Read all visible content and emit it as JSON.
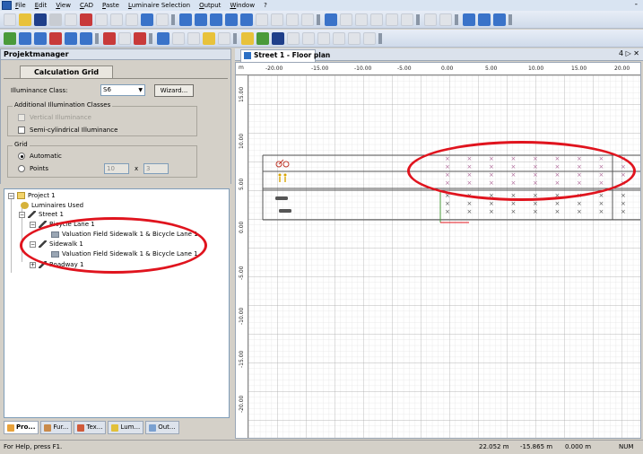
{
  "menu": {
    "items": [
      "File",
      "Edit",
      "View",
      "CAD",
      "Paste",
      "Luminaire Selection",
      "Output",
      "Window",
      "?"
    ],
    "minimize": "-"
  },
  "left_panel": {
    "title": "Projektmanager",
    "calc_tab": "Calculation Grid",
    "illuminance_label": "Illuminance Class:",
    "illuminance_value": "S6",
    "wizard_button": "Wizard...",
    "additional_group": "Additional Illumination Classes",
    "vertical_label": "Vertical Illuminance",
    "semicyl_label": "Semi-cylindrical Illuminance",
    "grid_group": "Grid",
    "automatic_label": "Automatic",
    "points_label": "Points",
    "points_x": "10",
    "points_sep": "x",
    "points_y": "3"
  },
  "tree": {
    "items": [
      "Project 1",
      "Luminaires Used",
      "Street 1",
      "Bicycle Lane 1",
      "Valuation Field Sidewalk 1 & Bicycle Lane 1",
      "Sidewalk 1",
      "Valuation Field Sidewalk 1 & Bicycle Lane 1",
      "Roadway 1"
    ]
  },
  "bottom_tabs": [
    "Pro...",
    "Fur...",
    "Tex...",
    "Lum...",
    "Out..."
  ],
  "document": {
    "tab_title": "Street 1 - Floor plan",
    "controls": "4 ▷ ✕",
    "h_unit": "m",
    "h_ticks": [
      "-20.00",
      "-15.00",
      "-10.00",
      "-5.00",
      "0.00",
      "5.00",
      "10.00",
      "15.00",
      "20.00"
    ],
    "v_ticks": [
      "15.00",
      "10.00",
      "5.00",
      "0.00",
      "-5.00",
      "-10.00",
      "-15.00",
      "-20.00"
    ]
  },
  "status": {
    "help": "For Help, press F1.",
    "x": "22.052 m",
    "y": "-15.865 m",
    "z": "0.000 m",
    "num": "NUM"
  },
  "colors": {
    "highlight_ring": "#e0141e",
    "menu_bg": "#d9e4f2",
    "panel_bg": "#d4d0c8"
  }
}
